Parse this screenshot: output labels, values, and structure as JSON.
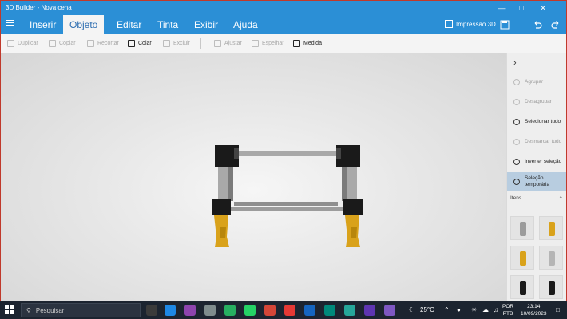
{
  "window": {
    "title": "3D Builder - Nova cena"
  },
  "ribbon": {
    "tabs": [
      "Inserir",
      "Objeto",
      "Editar",
      "Tinta",
      "Exibir",
      "Ajuda"
    ],
    "active_tab": "Objeto",
    "print_label": "Impressão 3D"
  },
  "toolbar": {
    "duplicate": "Duplicar",
    "copy": "Copiar",
    "cut": "Recortar",
    "paste": "Colar",
    "delete": "Excluir",
    "adjust": "Ajustar",
    "mirror": "Espelhar",
    "measure": "Medida"
  },
  "panel": {
    "group": "Agrupar",
    "ungroup": "Desagrupar",
    "select_all": "Selecionar tudo",
    "deselect_all": "Desmarcar tudo",
    "invert_selection": "Inverter seleção",
    "temp_selection_1": "Seleção",
    "temp_selection_2": "temporária",
    "items_header": "Itens"
  },
  "taskbar": {
    "search_placeholder": "Pesquisar",
    "temperature": "25°C",
    "lang1": "POR",
    "lang2": "PTB",
    "time": "23:14",
    "date": "10/09/2023"
  },
  "colors": {
    "accent": "#2b8fd6",
    "model_legs": "#d9a21b",
    "model_frame": "#9a9a9a",
    "model_connectors": "#1a1a1a"
  }
}
